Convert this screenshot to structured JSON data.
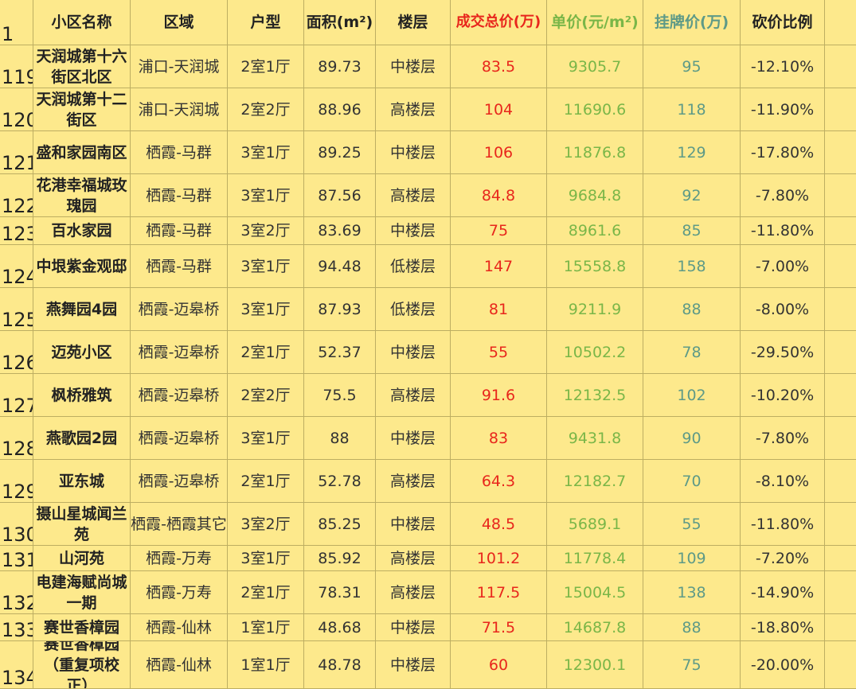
{
  "headers": {
    "row_num": "1",
    "name": "小区名称",
    "region": "区域",
    "layout": "户型",
    "area": "面积(m²)",
    "floor": "楼层",
    "total_price": "成交总价(万)",
    "unit_price": "单价(元/m²)",
    "list_price": "挂牌价(万)",
    "discount": "砍价比例"
  },
  "rows": [
    {
      "num": "119",
      "name": "天润城第十六街区北区",
      "region": "浦口-天润城",
      "layout": "2室1厅",
      "area": "89.73",
      "floor": "中楼层",
      "total": "83.5",
      "unit": "9305.7",
      "list": "95",
      "discount": "-12.10%"
    },
    {
      "num": "120",
      "name": "天润城第十二街区",
      "region": "浦口-天润城",
      "layout": "2室2厅",
      "area": "88.96",
      "floor": "高楼层",
      "total": "104",
      "unit": "11690.6",
      "list": "118",
      "discount": "-11.90%"
    },
    {
      "num": "121",
      "name": "盛和家园南区",
      "region": "栖霞-马群",
      "layout": "3室1厅",
      "area": "89.25",
      "floor": "中楼层",
      "total": "106",
      "unit": "11876.8",
      "list": "129",
      "discount": "-17.80%"
    },
    {
      "num": "122",
      "name": "花港幸福城玫瑰园",
      "region": "栖霞-马群",
      "layout": "3室1厅",
      "area": "87.56",
      "floor": "高楼层",
      "total": "84.8",
      "unit": "9684.8",
      "list": "92",
      "discount": "-7.80%"
    },
    {
      "num": "123",
      "name": "百水家园",
      "region": "栖霞-马群",
      "layout": "3室2厅",
      "area": "83.69",
      "floor": "中楼层",
      "total": "75",
      "unit": "8961.6",
      "list": "85",
      "discount": "-11.80%"
    },
    {
      "num": "124",
      "name": "中垠紫金观邸",
      "region": "栖霞-马群",
      "layout": "3室1厅",
      "area": "94.48",
      "floor": "低楼层",
      "total": "147",
      "unit": "15558.8",
      "list": "158",
      "discount": "-7.00%"
    },
    {
      "num": "125",
      "name": "燕舞园4园",
      "region": "栖霞-迈皋桥",
      "layout": "3室1厅",
      "area": "87.93",
      "floor": "低楼层",
      "total": "81",
      "unit": "9211.9",
      "list": "88",
      "discount": "-8.00%"
    },
    {
      "num": "126",
      "name": "迈苑小区",
      "region": "栖霞-迈皋桥",
      "layout": "2室1厅",
      "area": "52.37",
      "floor": "中楼层",
      "total": "55",
      "unit": "10502.2",
      "list": "78",
      "discount": "-29.50%"
    },
    {
      "num": "127",
      "name": "枫桥雅筑",
      "region": "栖霞-迈皋桥",
      "layout": "2室2厅",
      "area": "75.5",
      "floor": "高楼层",
      "total": "91.6",
      "unit": "12132.5",
      "list": "102",
      "discount": "-10.20%"
    },
    {
      "num": "128",
      "name": "燕歌园2园",
      "region": "栖霞-迈皋桥",
      "layout": "3室1厅",
      "area": "88",
      "floor": "中楼层",
      "total": "83",
      "unit": "9431.8",
      "list": "90",
      "discount": "-7.80%"
    },
    {
      "num": "129",
      "name": "亚东城",
      "region": "栖霞-迈皋桥",
      "layout": "2室1厅",
      "area": "52.78",
      "floor": "高楼层",
      "total": "64.3",
      "unit": "12182.7",
      "list": "70",
      "discount": "-8.10%"
    },
    {
      "num": "130",
      "name": "摄山星城闻兰苑",
      "region": "栖霞-栖霞其它",
      "layout": "3室2厅",
      "area": "85.25",
      "floor": "中楼层",
      "total": "48.5",
      "unit": "5689.1",
      "list": "55",
      "discount": "-11.80%"
    },
    {
      "num": "131",
      "name": "山河苑",
      "region": "栖霞-万寿",
      "layout": "3室1厅",
      "area": "85.92",
      "floor": "高楼层",
      "total": "101.2",
      "unit": "11778.4",
      "list": "109",
      "discount": "-7.20%"
    },
    {
      "num": "132",
      "name": "电建海赋尚城一期",
      "region": "栖霞-万寿",
      "layout": "2室1厅",
      "area": "78.31",
      "floor": "高楼层",
      "total": "117.5",
      "unit": "15004.5",
      "list": "138",
      "discount": "-14.90%"
    },
    {
      "num": "133",
      "name": "赛世香樟园",
      "region": "栖霞-仙林",
      "layout": "1室1厅",
      "area": "48.68",
      "floor": "中楼层",
      "total": "71.5",
      "unit": "14687.8",
      "list": "88",
      "discount": "-18.80%"
    },
    {
      "num": "134",
      "name": "赛世香樟园（重复项校正）",
      "region": "栖霞-仙林",
      "layout": "1室1厅",
      "area": "48.78",
      "floor": "中楼层",
      "total": "60",
      "unit": "12300.1",
      "list": "75",
      "discount": "-20.00%"
    }
  ],
  "colors": {
    "background": "#fde98c",
    "grid": "#bdae62",
    "total_price": "#e8261c",
    "unit_price": "#7ab648",
    "list_price": "#5e9a87"
  }
}
